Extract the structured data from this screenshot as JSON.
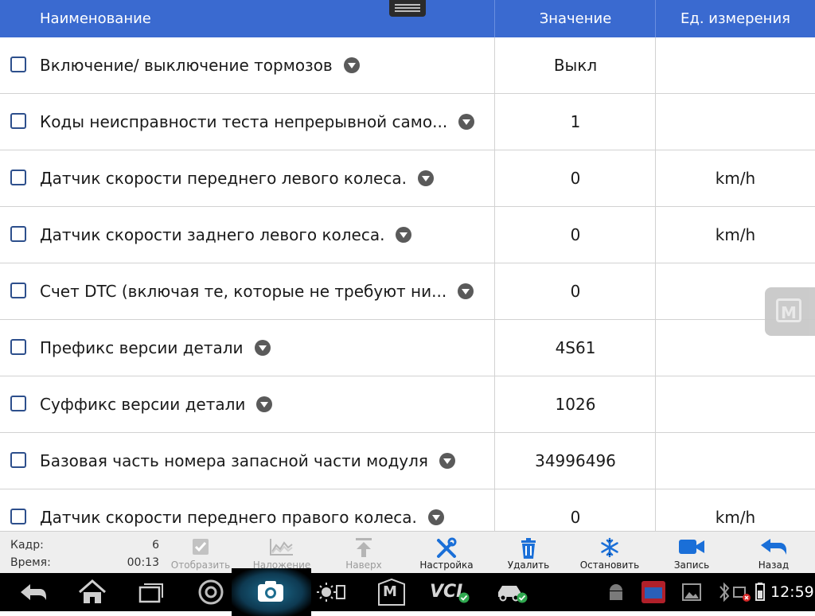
{
  "header": {
    "name_col": "Наименование",
    "value_col": "Значение",
    "unit_col": "Ед. измерения"
  },
  "rows": [
    {
      "name": "Включение/ выключение тормозов",
      "value": "Выкл",
      "unit": ""
    },
    {
      "name": "Коды неисправности теста непрерывной само...",
      "value": "1",
      "unit": ""
    },
    {
      "name": "Датчик скорости переднего левого колеса.",
      "value": "0",
      "unit": "km/h"
    },
    {
      "name": "Датчик скорости заднего левого колеса.",
      "value": "0",
      "unit": "km/h"
    },
    {
      "name": "Счет DTC (включая те, которые не требуют ни...",
      "value": "0",
      "unit": ""
    },
    {
      "name": "Префикс версии детали",
      "value": "4S61",
      "unit": ""
    },
    {
      "name": "Суффикс версии детали",
      "value": "1026",
      "unit": ""
    },
    {
      "name": "Базовая часть номера запасной части модуля",
      "value": "34996496",
      "unit": ""
    },
    {
      "name": "Датчик скорости переднего правого колеса.",
      "value": "0",
      "unit": "km/h"
    }
  ],
  "float_button": {
    "letter": "M"
  },
  "toolbar": {
    "frame_label": "Кадр:",
    "frame_value": "6",
    "time_label": "Время:",
    "time_value": "00:13",
    "buttons": [
      {
        "label": "Отобразить",
        "icon": "checkbox-icon",
        "enabled": false
      },
      {
        "label": "Наложение",
        "icon": "overlay-chart-icon",
        "enabled": false
      },
      {
        "label": "Наверх",
        "icon": "move-top-icon",
        "enabled": false
      },
      {
        "label": "Настройка",
        "icon": "wrench-icon",
        "enabled": true
      },
      {
        "label": "Удалить",
        "icon": "trash-icon",
        "enabled": true
      },
      {
        "label": "Остановить",
        "icon": "snowflake-icon",
        "enabled": true
      },
      {
        "label": "Запись",
        "icon": "video-camera-icon",
        "enabled": true
      },
      {
        "label": "Назад",
        "icon": "back-arrow-icon",
        "enabled": true
      }
    ]
  },
  "navbar": {
    "vci_label": "VCI",
    "m_label": "M",
    "clock": "12:59"
  },
  "colors": {
    "header_bg": "#3a6ad0",
    "accent_blue": "#1a6fd8",
    "nav_bg": "#000000"
  }
}
